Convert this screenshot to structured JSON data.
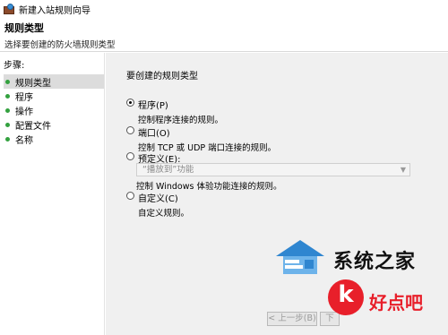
{
  "window": {
    "title": "新建入站规则向导"
  },
  "header": {
    "heading": "规则类型",
    "description": "选择要创建的防火墙规则类型"
  },
  "steps": {
    "title": "步骤:",
    "items": [
      {
        "label": "规则类型"
      },
      {
        "label": "程序"
      },
      {
        "label": "操作"
      },
      {
        "label": "配置文件"
      },
      {
        "label": "名称"
      }
    ]
  },
  "main": {
    "question": "要创建的规则类型",
    "options": [
      {
        "label": "程序(P)",
        "desc": "控制程序连接的规则。",
        "checked": true
      },
      {
        "label": "端口(O)",
        "desc": "控制 TCP 或 UDP 端口连接的规则。",
        "checked": false
      },
      {
        "label": "预定义(E):",
        "desc": "控制 Windows 体验功能连接的规则。",
        "checked": false
      },
      {
        "label": "自定义(C)",
        "desc": "自定义规则。",
        "checked": false
      }
    ],
    "predefined_select": {
      "value": "“播放到”功能"
    }
  },
  "buttons": {
    "back": "< 上一步(B)",
    "next": "下"
  },
  "watermarks": {
    "site1": "系统之家",
    "site2": "好点吧"
  }
}
